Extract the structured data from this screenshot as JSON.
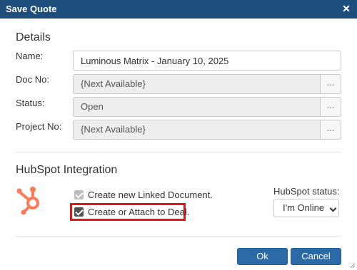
{
  "dialog": {
    "title": "Save Quote",
    "close_glyph": "✕",
    "close_icon": "close-icon",
    "accent_color": "#1e4f7c"
  },
  "details": {
    "heading": "Details",
    "name_label": "Name:",
    "name_value": "Luminous Matrix - January 10, 2025",
    "doc_no_label": "Doc No:",
    "doc_no_value": "{Next Available}",
    "status_label": "Status:",
    "status_value": "Open",
    "project_no_label": "Project No:",
    "project_no_value": "{Next Available}",
    "picker_button_label": "..."
  },
  "hubspot": {
    "heading": "HubSpot Integration",
    "logo_icon": "hubspot-logo-icon",
    "logo_color": "#ff7a59",
    "create_linked_label": "Create new Linked Document.",
    "create_linked_checked": true,
    "create_linked_disabled": true,
    "attach_deal_label": "Create or Attach to Deal.",
    "attach_deal_checked": true,
    "highlight_color": "#e01515",
    "status_label": "HubSpot status:",
    "status_value": "I'm Online"
  },
  "footer": {
    "ok_label": "Ok",
    "cancel_label": "Cancel",
    "button_color": "#2b6aa6"
  }
}
